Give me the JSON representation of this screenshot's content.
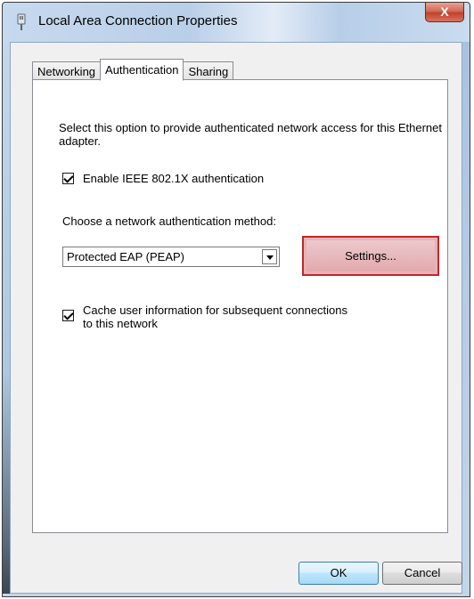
{
  "window": {
    "title": "Local Area Connection Properties",
    "close_label": "X"
  },
  "tabs": [
    {
      "label": "Networking",
      "active": false
    },
    {
      "label": "Authentication",
      "active": true
    },
    {
      "label": "Sharing",
      "active": false
    }
  ],
  "authentication": {
    "description": "Select this option to provide authenticated network access for this Ethernet adapter.",
    "enable_checkbox": {
      "label": "Enable IEEE 802.1X authentication",
      "checked": true
    },
    "method_label": "Choose a network authentication method:",
    "method_select": {
      "value": "Protected EAP (PEAP)"
    },
    "settings_button": "Settings...",
    "cache_checkbox": {
      "label_line1": "Cache user information for subsequent connections",
      "label_line2": "to this network",
      "checked": true
    }
  },
  "footer": {
    "ok_label": "OK",
    "cancel_label": "Cancel"
  },
  "colors": {
    "highlight_border": "#c0262d",
    "highlight_fill": "#e7b2b6"
  }
}
